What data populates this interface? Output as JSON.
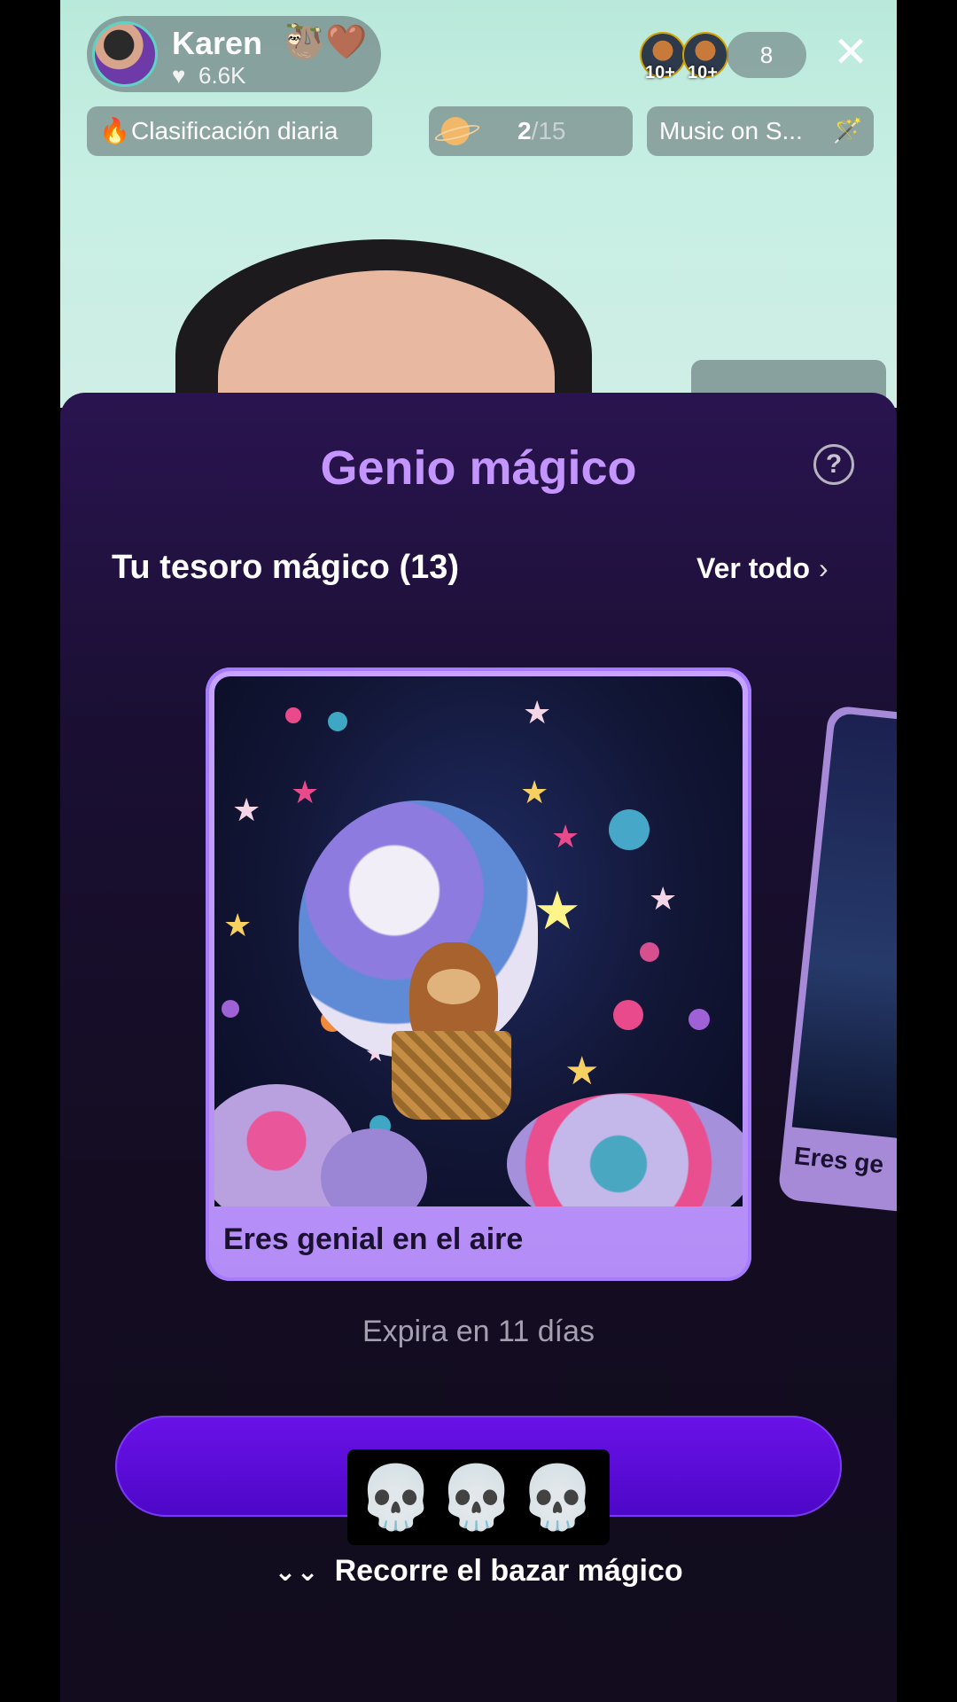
{
  "host": {
    "name": "Karen",
    "emoji": "🦥🤎",
    "likes": "6.6K"
  },
  "viewers": {
    "badges": [
      "10+",
      "10+"
    ],
    "count": "8"
  },
  "chips": {
    "ranking": "Clasificación diaria",
    "planet_current": "2",
    "planet_total": "/15",
    "music": "Music on S..."
  },
  "sheet": {
    "title": "Genio mágico",
    "treasure_title": "Tu tesoro mágico (13)",
    "see_all": "Ver todo",
    "card_caption": "Eres genial en el aire",
    "peek_caption": "Eres ge",
    "expiry": "Expira en 11 días",
    "censor": "💀💀💀",
    "browse": "Recorre el bazar mágico"
  }
}
